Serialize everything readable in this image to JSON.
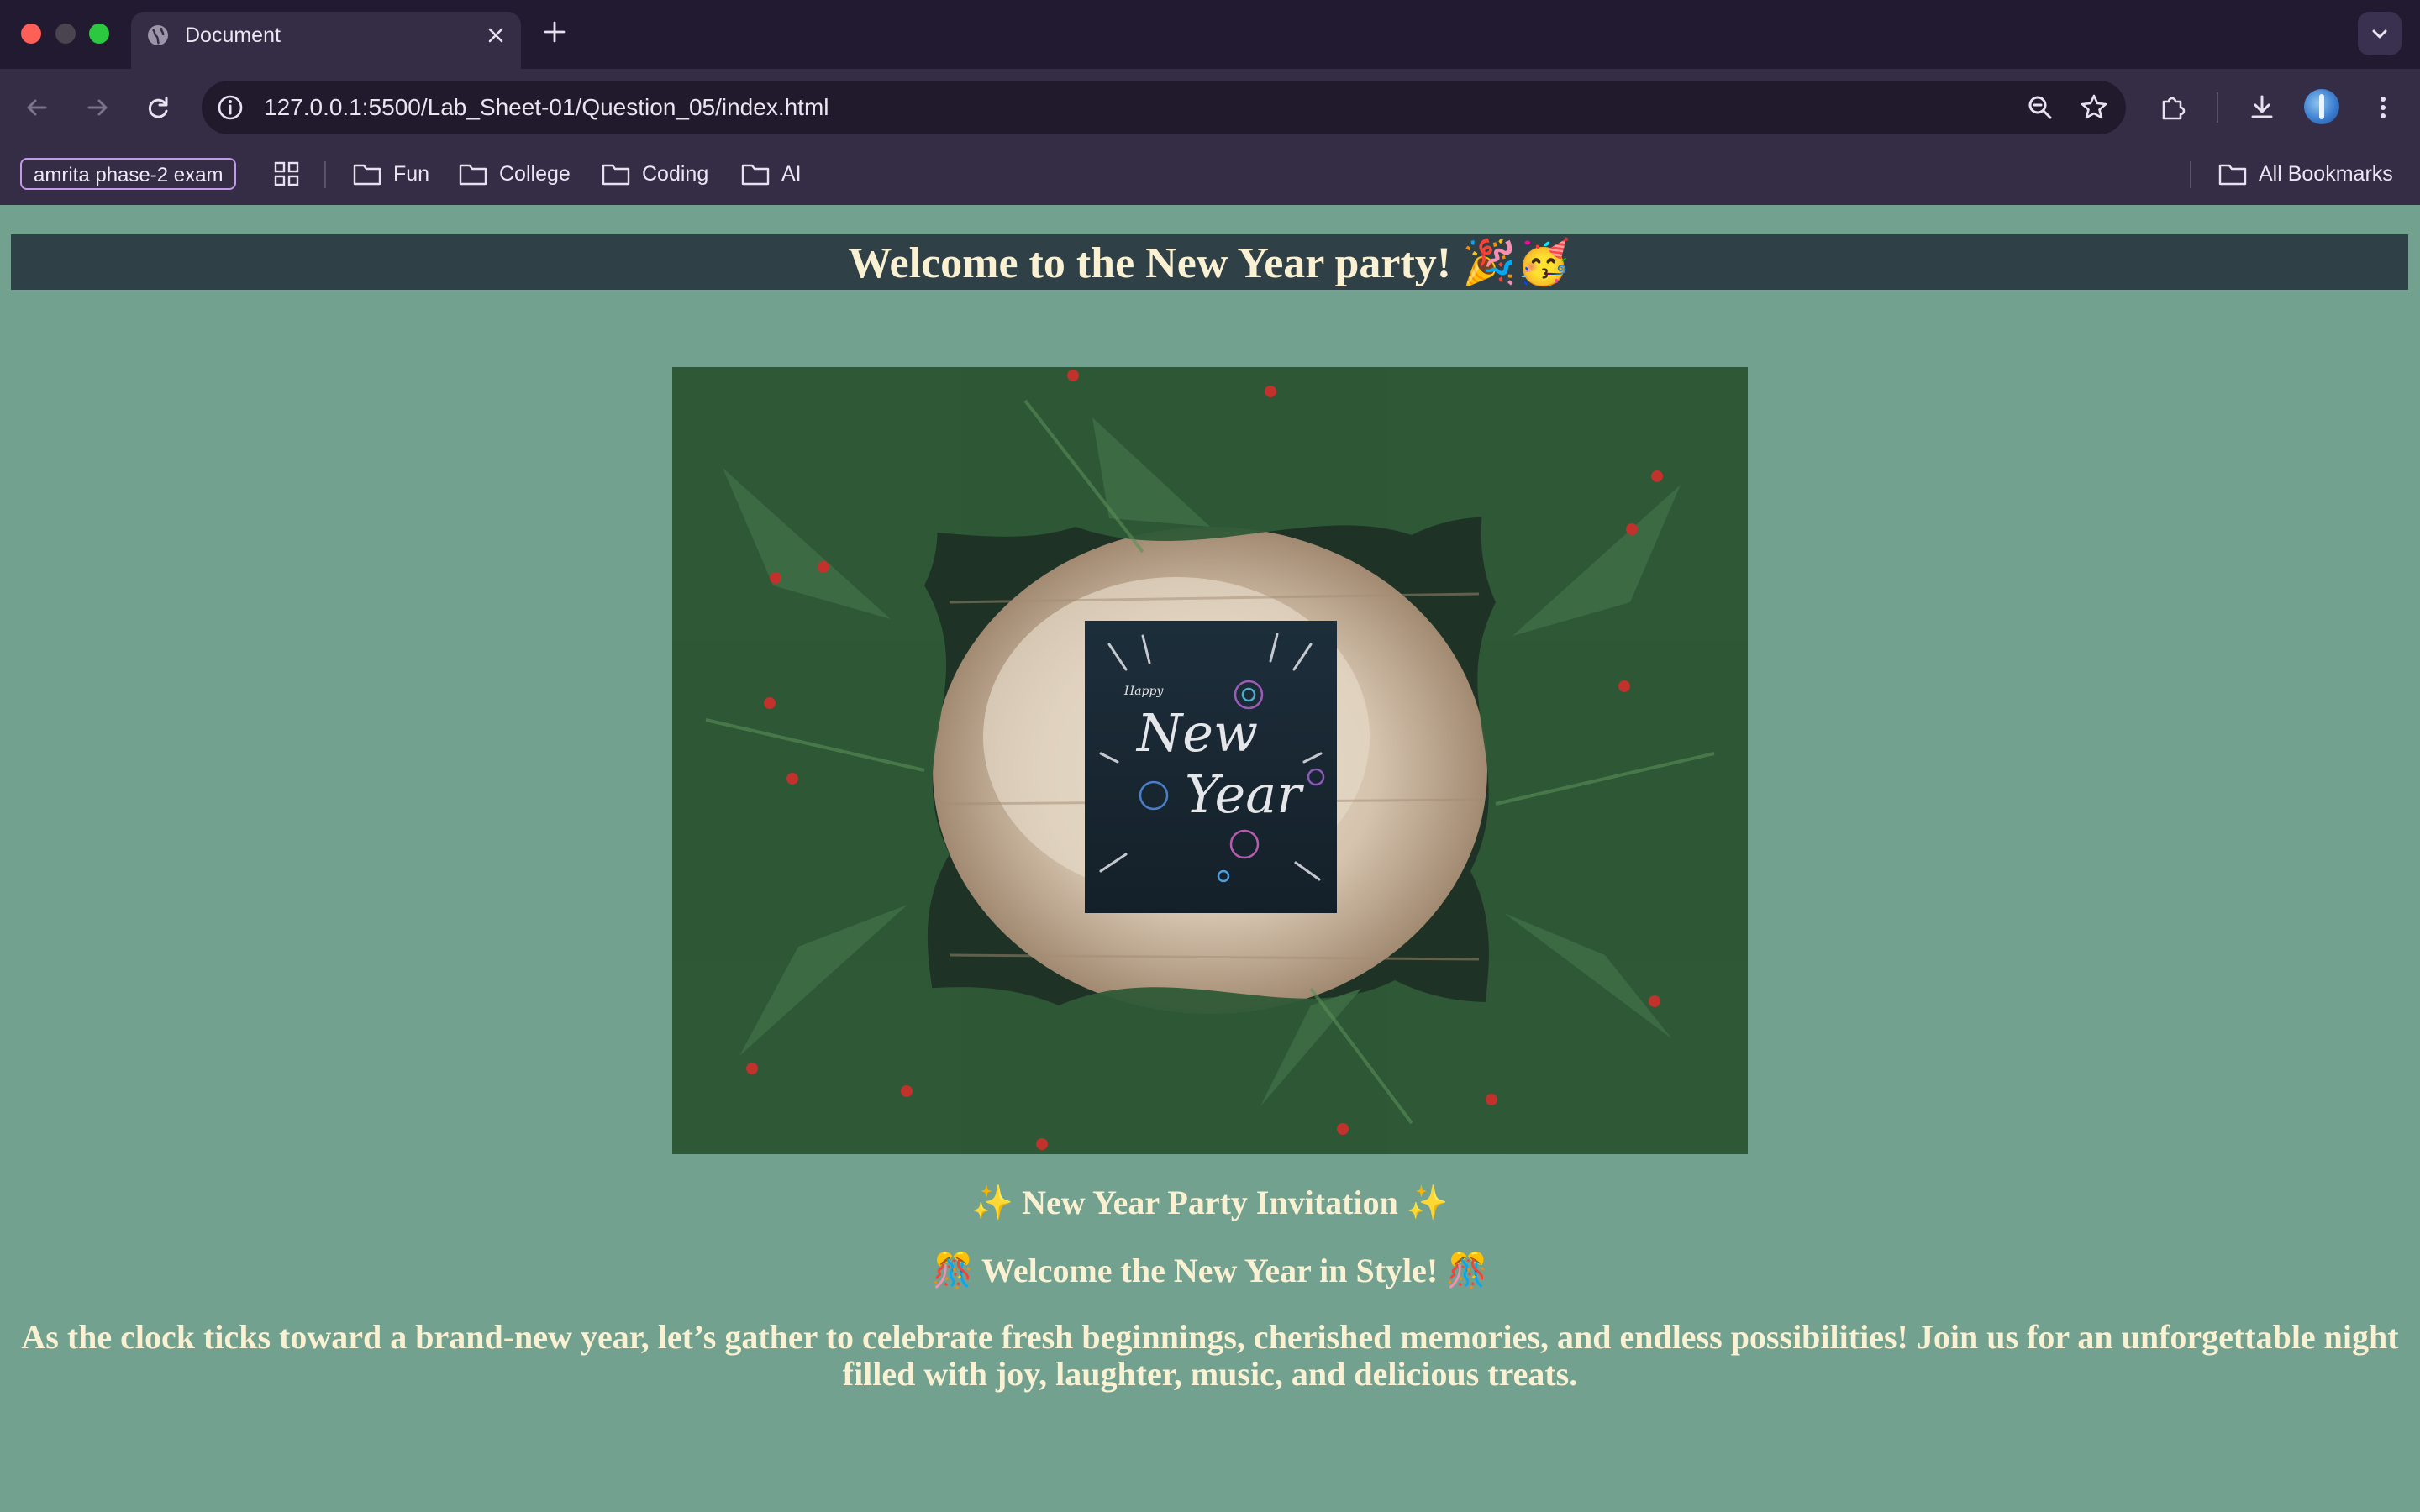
{
  "browser": {
    "tab": {
      "title": "Document"
    },
    "url": "127.0.0.1:5500/Lab_Sheet-01/Question_05/index.html",
    "bookmarks": {
      "chip": "amrita phase-2 exam",
      "folders": [
        "Fun",
        "College",
        "Coding",
        "AI"
      ],
      "all": "All Bookmarks"
    }
  },
  "page": {
    "heading": "Welcome to the New Year party! 🎉🥳",
    "image": {
      "card_small_text": "Happy",
      "card_text_line1": "New",
      "card_text_line2": "Year"
    },
    "invitation_title": "✨ New Year Party Invitation ✨",
    "welcome_line": "🎊 Welcome the New Year in Style! 🎊",
    "paragraph": "As the clock ticks toward a brand-new year, let’s gather to celebrate fresh beginnings, cherished memories, and endless possibilities! Join us for an unforgettable night filled with joy, laughter, music, and delicious treats."
  },
  "colors": {
    "page_bg": "#72a190",
    "banner_bg": "#2f4047",
    "text": "#faf0d2",
    "chrome_bg": "#352c45",
    "tabstrip_bg": "#221a30"
  }
}
